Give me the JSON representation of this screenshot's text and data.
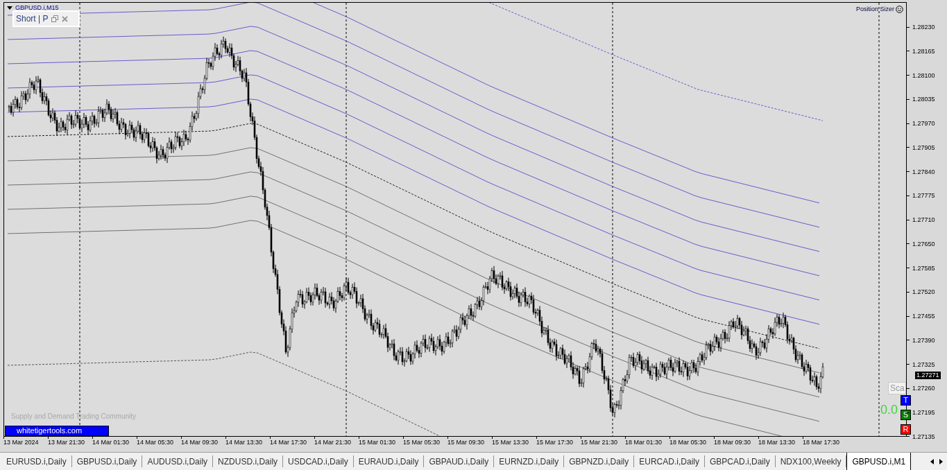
{
  "chart": {
    "title": "GBPUSD.i,M15",
    "trade_panel": "Short | P",
    "position_sizer": "Position Sizer",
    "overlay_text": "Supply and Demand Trading Community",
    "site_label": "whitetigertools.com",
    "scale_button": "Sca",
    "readout": "0.0",
    "buttons": [
      {
        "label": "T",
        "color": "#0000ff"
      },
      {
        "label": "S",
        "color": "#008000"
      },
      {
        "label": "R",
        "color": "#ff0000"
      }
    ]
  },
  "price_axis": {
    "ticks": [
      "1.28230",
      "1.28165",
      "1.28100",
      "1.28035",
      "1.27970",
      "1.27905",
      "1.27840",
      "1.27775",
      "1.27710",
      "1.27650",
      "1.27585",
      "1.27520",
      "1.27455",
      "1.27390",
      "1.27325",
      "1.27260",
      "1.27195",
      "1.27135"
    ],
    "current_price": "1.27271"
  },
  "time_axis": {
    "labels": [
      "13 Mar 2024",
      "13 Mar 21:30",
      "14 Mar 01:30",
      "14 Mar 05:30",
      "14 Mar 09:30",
      "14 Mar 13:30",
      "14 Mar 17:30",
      "14 Mar 21:30",
      "15 Mar 01:30",
      "15 Mar 05:30",
      "15 Mar 09:30",
      "15 Mar 13:30",
      "15 Mar 17:30",
      "15 Mar 21:30",
      "18 Mar 01:30",
      "18 Mar 05:30",
      "18 Mar 09:30",
      "18 Mar 13:30",
      "18 Mar 17:30"
    ]
  },
  "tabs": [
    {
      "label": "EURUSD.i,Daily",
      "selected": false
    },
    {
      "label": "GBPUSD.i,Daily",
      "selected": false
    },
    {
      "label": "AUDUSD.i,Daily",
      "selected": false
    },
    {
      "label": "NZDUSD.i,Daily",
      "selected": false
    },
    {
      "label": "USDCAD.i,Daily",
      "selected": false
    },
    {
      "label": "EURAUD.i,Daily",
      "selected": false
    },
    {
      "label": "GBPAUD.i,Daily",
      "selected": false
    },
    {
      "label": "EURNZD.i,Daily",
      "selected": false
    },
    {
      "label": "GBPNZD.i,Daily",
      "selected": false
    },
    {
      "label": "EURCAD.i,Daily",
      "selected": false
    },
    {
      "label": "GBPCAD.i,Daily",
      "selected": false
    },
    {
      "label": "NDX100,Weekly",
      "selected": false
    },
    {
      "label": "GBPUSD.i,M1",
      "selected": true
    }
  ]
}
